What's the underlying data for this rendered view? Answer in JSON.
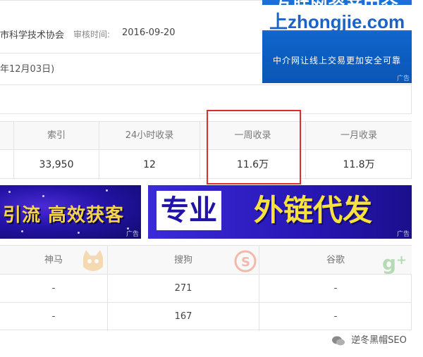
{
  "site_info": {
    "organization": "市科学技术协会",
    "audit_label": "审核时间:",
    "audit_value": "2016-09-20",
    "date_note": "年12月03日)"
  },
  "ad_top": {
    "headline": "互联网资产中介",
    "domain": "上zhongjie.com",
    "slogan": "中介网让线上交易更加安全可靠",
    "tag": "广告"
  },
  "stats": {
    "headers": [
      "索引",
      "24小时收录",
      "一周收录",
      "一月收录"
    ],
    "values": [
      "33,950",
      "12",
      "11.6万",
      "11.8万"
    ]
  },
  "ad_left": {
    "text": "引流 高效获客",
    "tag": "广告"
  },
  "ad_right": {
    "text1": "专业",
    "text2": "外链代发",
    "tag": "广告"
  },
  "engines": {
    "headers": [
      "神马",
      "搜狗",
      "谷歌"
    ],
    "rows": [
      [
        "-",
        "271",
        "-"
      ],
      [
        "-",
        "167",
        "-"
      ]
    ]
  },
  "watermark": {
    "text": "逆冬黑帽SEO"
  },
  "colors": {
    "highlight": "#d9302c",
    "ad_blue": "#1b63c9",
    "ad_yellow": "#f7e13e"
  }
}
